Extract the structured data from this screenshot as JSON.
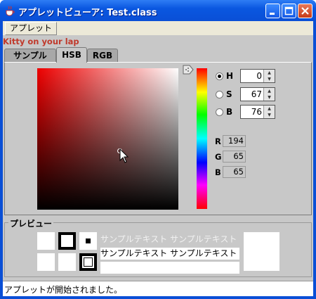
{
  "window": {
    "title": "アプレットビューア: Test.class"
  },
  "menubar": {
    "applet_menu": "アプレット"
  },
  "banner": {
    "text": "Kitty on your lap"
  },
  "tabs": [
    {
      "label": "サンプル"
    },
    {
      "label": "HSB",
      "selected": true
    },
    {
      "label": "RGB"
    }
  ],
  "hsb": {
    "h": {
      "label": "H",
      "value": "0",
      "selected": true
    },
    "s": {
      "label": "S",
      "value": "67"
    },
    "b": {
      "label": "B",
      "value": "76"
    }
  },
  "rgb": {
    "r": {
      "label": "R",
      "value": "194"
    },
    "g": {
      "label": "G",
      "value": "65"
    },
    "b": {
      "label": "B",
      "value": "65"
    }
  },
  "preview": {
    "legend": "プレビュー",
    "sample_text_faded": "サンプルテキスト サンプルテキスト",
    "sample_text": "サンプルテキスト サンプルテキスト"
  },
  "status": {
    "text": "アプレットが開始されました。"
  },
  "colors": {
    "selected": "#c24141",
    "titlebar": "#0a4fd6",
    "banner_text": "#c0392b"
  }
}
